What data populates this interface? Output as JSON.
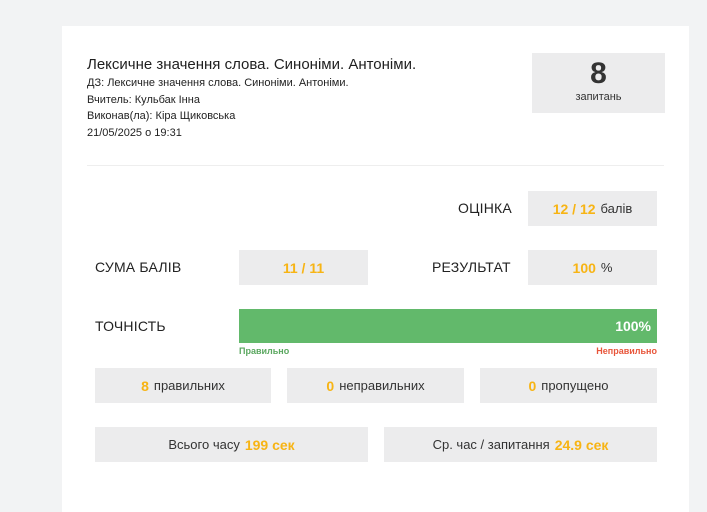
{
  "header": {
    "title": "Лексичне значення слова. Синоніми. Антоніми.",
    "homework": "ДЗ: Лексичне значення слова. Синоніми. Антоніми.",
    "teacher": "Вчитель: Кульбак Інна",
    "performer": "Виконав(ла): Кіра Щиковська",
    "datetime": "21/05/2025 о 19:31"
  },
  "questions": {
    "count": "8",
    "label": "запитань"
  },
  "grade": {
    "label": "ОЦІНКА",
    "value": "12 / 12",
    "unit": "балів"
  },
  "score": {
    "label": "СУМА БАЛІВ",
    "value": "11 / 11"
  },
  "result": {
    "label": "РЕЗУЛЬТАТ",
    "value": "100",
    "unit": "%"
  },
  "accuracy": {
    "label": "ТОЧНІСТЬ",
    "percent_text": "100%",
    "fraction": 1.0,
    "correct_label": "Правильно",
    "incorrect_label": "Неправильно"
  },
  "stats": {
    "correct": {
      "value": "8",
      "label": "правильних"
    },
    "incorrect": {
      "value": "0",
      "label": "неправильних"
    },
    "skipped": {
      "value": "0",
      "label": "пропущено"
    }
  },
  "time": {
    "total_label": "Всього часу",
    "total_value": "199 сек",
    "avg_label": "Ср. час / запитання",
    "avg_value": "24.9 сек"
  },
  "colors": {
    "accent": "#f7b414",
    "bar_green": "#62b96b",
    "correct_text": "#5aa75f",
    "incorrect_text": "#e8553a",
    "box_bg": "#ececed"
  }
}
